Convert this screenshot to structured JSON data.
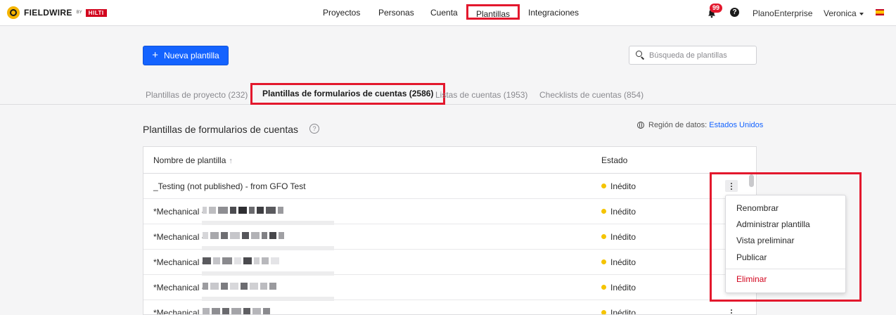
{
  "brand": {
    "name": "FIELDWIRE",
    "by": "BY",
    "partner": "HILTI"
  },
  "nav": [
    {
      "label": "Proyectos",
      "active": false
    },
    {
      "label": "Personas",
      "active": false
    },
    {
      "label": "Cuenta",
      "active": false
    },
    {
      "label": "Plantillas",
      "active": true
    },
    {
      "label": "Integraciones",
      "active": false
    }
  ],
  "header_right": {
    "notifications": "99",
    "company": "PlanoEnterprise",
    "user": "Veronica"
  },
  "toolbar": {
    "new_template_label": "Nueva plantilla",
    "search_placeholder": "Búsqueda de plantillas"
  },
  "tabs": [
    {
      "label": "Plantillas de proyecto (232)",
      "active": false
    },
    {
      "label": "Plantillas de formularios de cuentas (2586)",
      "active": true
    },
    {
      "label": "Listas de cuentas (1953)",
      "active": false
    },
    {
      "label": "Checklists de cuentas (854)",
      "active": false
    }
  ],
  "section": {
    "title": "Plantillas de formularios de cuentas",
    "region_label": "Región de datos:",
    "region_value": "Estados Unidos"
  },
  "table": {
    "headers": {
      "name": "Nombre de plantilla",
      "status": "Estado"
    },
    "rows": [
      {
        "name": "_Testing (not published) - from GFO Test",
        "status": "Inédito"
      },
      {
        "name": "*Mechanical -",
        "status": "Inédito"
      },
      {
        "name": "*Mechanical -",
        "status": "Inédito"
      },
      {
        "name": "*Mechanical -",
        "status": "Inédito"
      },
      {
        "name": "*Mechanical -",
        "status": "Inédito"
      },
      {
        "name": "*Mechanical",
        "status": "Inédito"
      }
    ]
  },
  "context_menu": {
    "items": [
      "Renombrar",
      "Administrar plantilla",
      "Vista preliminar",
      "Publicar"
    ],
    "danger": "Eliminar"
  },
  "colors": {
    "primary": "#1463ff",
    "highlight": "#e3182d",
    "status_unpublished": "#f5c400",
    "danger": "#d2051e"
  }
}
